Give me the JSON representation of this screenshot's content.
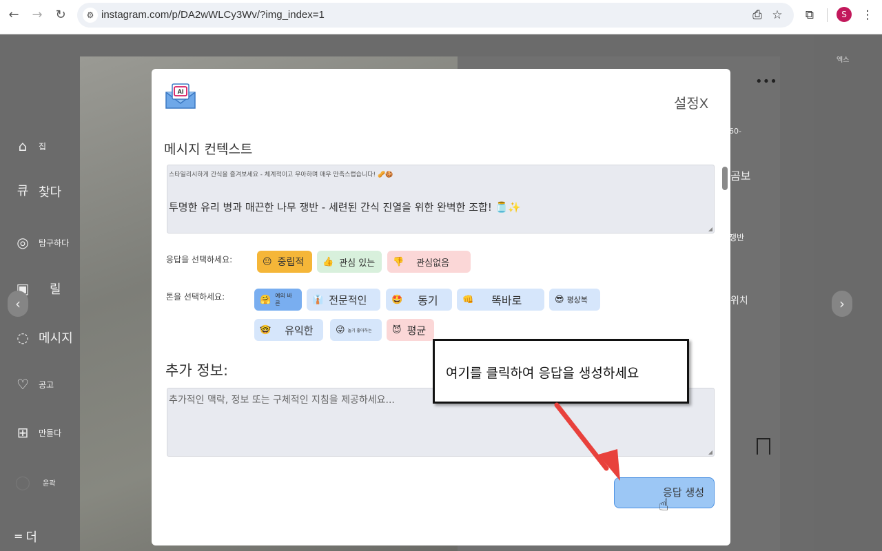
{
  "browser": {
    "url": "instagram.com/p/DA2wWLCy3Wv/?img_index=1",
    "profile_initial": "S"
  },
  "page": {
    "right_label": "엑스",
    "sidebar": [
      {
        "icon": "home-icon",
        "glyph": "⌂",
        "label": "집",
        "big": false
      },
      {
        "icon": "search-icon",
        "glyph": "큐",
        "label": "찾다",
        "big": true
      },
      {
        "icon": "compass-icon",
        "glyph": "◎",
        "label": "탐구하다",
        "big": false
      },
      {
        "icon": "reels-icon",
        "glyph": "▣",
        "label": "릴",
        "big": true
      },
      {
        "icon": "messenger-icon",
        "glyph": "◌",
        "label": "메시지",
        "big": true
      },
      {
        "icon": "heart-icon",
        "glyph": "♡",
        "label": "공고",
        "big": false
      },
      {
        "icon": "plus-square-icon",
        "glyph": "⊞",
        "label": "만들다",
        "big": false
      },
      {
        "icon": "profile-icon",
        "glyph": "◯",
        "label": "윤곽",
        "big": false
      },
      {
        "icon": "menu-icon",
        "glyph": "=",
        "label": "더",
        "big": true
      }
    ],
    "post_fragments": [
      "곰보",
      "쟁반",
      "위치",
      "60-"
    ]
  },
  "modal": {
    "settings_label": "설정X",
    "context_title": "메시지 컨텍스트",
    "context_line1": "스타일리시하게 간식을 즐겨보세요 - 체계적이고 우아하며 매우 만족스럽습니다! 🥜🍪",
    "context_line2": "투명한 유리 병과 매끈한 나무 쟁반 - 세련된 간식 진열을 위한 완벽한 조합! 🫙✨",
    "response_label": "응답을 선택하세요:",
    "responses": [
      {
        "emoji": "😐",
        "label": "중립적",
        "selected": true
      },
      {
        "emoji": "👍",
        "label": "관심 있는",
        "selected": false
      },
      {
        "emoji": "👎",
        "label": "관심없음",
        "selected": false
      }
    ],
    "tone_label": "톤을 선택하세요:",
    "tones": [
      {
        "emoji": "🤗",
        "label": "예의 바른",
        "tiny": true,
        "selected": true
      },
      {
        "emoji": "👔",
        "label": "전문적인",
        "tiny": false,
        "selected": false
      },
      {
        "emoji": "🤩",
        "label": "동기",
        "tiny": false,
        "selected": false
      },
      {
        "emoji": "👊",
        "label": "똑바로",
        "tiny": false,
        "selected": false
      },
      {
        "emoji": "😎",
        "label": "평상복",
        "tiny": false,
        "selected": false
      },
      {
        "emoji": "🤓",
        "label": "유익한",
        "tiny": false,
        "selected": false
      },
      {
        "emoji": "😜",
        "label": "놀기 좋아하는",
        "tiny": true,
        "selected": false
      },
      {
        "emoji": "😈",
        "label": "평균",
        "tiny": false,
        "selected": false
      }
    ],
    "extra_title": "추가 정보:",
    "extra_placeholder": "추가적인 맥락, 정보 또는 구체적인 지침을 제공하세요...",
    "generate_label": "응답 생성"
  },
  "callout": {
    "text": "여기를 클릭하여 응답을 생성하세요"
  },
  "colors": {
    "accent_blue": "#79aef0",
    "selected_orange": "#f5b638",
    "arrow_red": "#e8413c"
  }
}
